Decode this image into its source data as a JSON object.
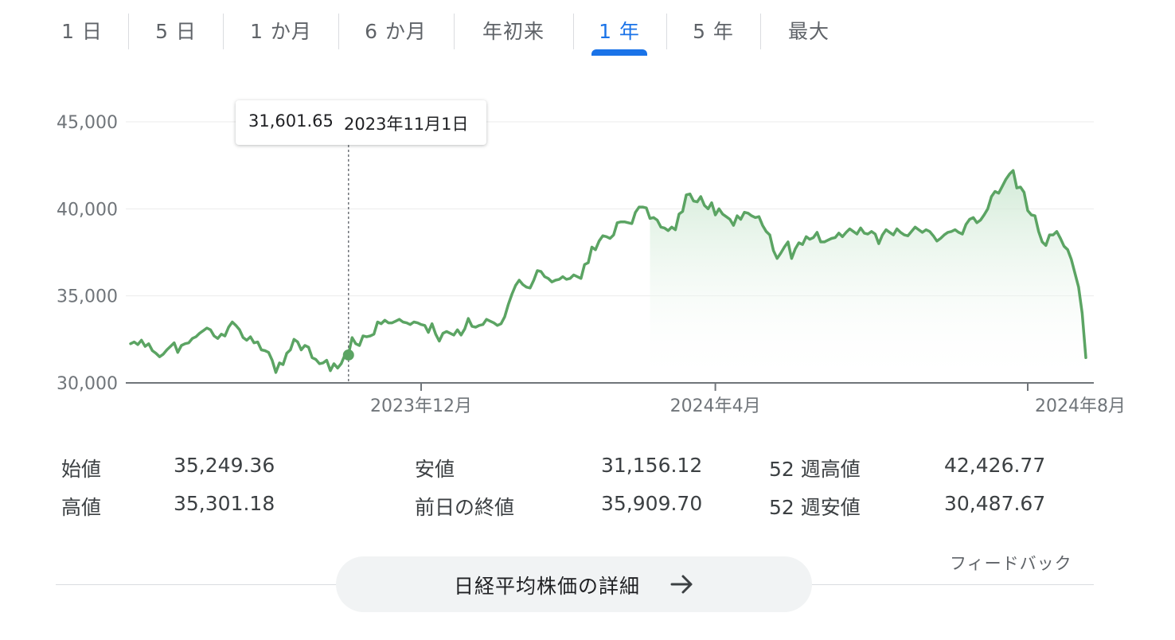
{
  "range_tabs": [
    "1 日",
    "5 日",
    "1 か月",
    "6 か月",
    "年初来",
    "1 年",
    "5 年",
    "最大"
  ],
  "selected_tab": "1 年",
  "tooltip": {
    "value": "31,601.65",
    "date": "2023年11月1日"
  },
  "stats": {
    "open": {
      "label": "始値",
      "value": "35,249.36"
    },
    "high": {
      "label": "高値",
      "value": "35,301.18"
    },
    "low": {
      "label": "安値",
      "value": "31,156.12"
    },
    "prev_close": {
      "label": "前日の終値",
      "value": "35,909.70"
    },
    "week52_high": {
      "label": "52 週高値",
      "value": "42,426.77"
    },
    "week52_low": {
      "label": "52 週安値",
      "value": "30,487.67"
    }
  },
  "details_button": "日経平均株価の詳細",
  "feedback": "フィードバック",
  "colors": {
    "accent": "#1a73e8",
    "line": "#5ba463",
    "area": "#e6f4ea",
    "grid": "#ebebeb"
  },
  "icons": {
    "details_arrow": "arrow-right-icon"
  },
  "chart_data": {
    "type": "area",
    "y_ticks": [
      "45,000",
      "40,000",
      "35,000",
      "30,000"
    ],
    "x_ticks": [
      "2023年12月",
      "2024年4月",
      "2024年8月"
    ],
    "ylim": [
      30000,
      45000
    ],
    "grid": true,
    "highlight": {
      "date": "2023年11月1日",
      "value": 31601.65
    },
    "series": [
      {
        "values": [
          32250,
          32350,
          32200,
          32450,
          32100,
          32250,
          31850,
          31700,
          31500,
          31650,
          31900,
          32100,
          32300,
          31750,
          32150,
          32250,
          32300,
          32550,
          32650,
          32850,
          33000,
          33150,
          33050,
          32700,
          32550,
          32800,
          32700,
          33200,
          33500,
          33300,
          33050,
          32600,
          32450,
          32650,
          32300,
          32350,
          31900,
          31850,
          31750,
          31300,
          30600,
          31150,
          31050,
          31700,
          31900,
          32500,
          32350,
          31900,
          32150,
          32050,
          31450,
          31350,
          31100,
          31150,
          31300,
          30700,
          31100,
          30850,
          31100,
          31600,
          31650,
          32600,
          32250,
          32150,
          32700,
          32650,
          32700,
          32800,
          33500,
          33400,
          33600,
          33450,
          33450,
          33550,
          33650,
          33500,
          33450,
          33350,
          33500,
          33450,
          33350,
          33300,
          32900,
          33400,
          32800,
          32400,
          32850,
          32950,
          32850,
          32750,
          33050,
          32750,
          33100,
          33700,
          33250,
          33200,
          33300,
          33350,
          33650,
          33550,
          33450,
          33300,
          33400,
          33800,
          34500,
          35100,
          35600,
          35900,
          35650,
          35500,
          35450,
          35900,
          36450,
          36400,
          36100,
          36000,
          35800,
          35900,
          35950,
          36100,
          35950,
          36000,
          36200,
          36100,
          36000,
          36800,
          36900,
          37800,
          37650,
          38150,
          38450,
          38400,
          38300,
          38500,
          39200,
          39250,
          39250,
          39200,
          39150,
          39800,
          40100,
          40100,
          40050,
          39450,
          39500,
          39350,
          38950,
          38900,
          38750,
          38950,
          38800,
          39700,
          39850,
          40800,
          40850,
          40450,
          40400,
          40700,
          40200,
          40000,
          40350,
          39650,
          40000,
          39700,
          39550,
          39400,
          39050,
          39600,
          39400,
          39800,
          39750,
          39600,
          39500,
          39550,
          39050,
          38700,
          38500,
          37600,
          37150,
          37450,
          37800,
          38100,
          37150,
          37700,
          38050,
          37950,
          38400,
          38250,
          38350,
          38650,
          38100,
          38100,
          38200,
          38300,
          38350,
          38600,
          38400,
          38650,
          38850,
          38700,
          38550,
          38900,
          38600,
          38550,
          38700,
          38550,
          38000,
          38500,
          38800,
          38650,
          38500,
          38850,
          38650,
          38500,
          38450,
          38700,
          38950,
          38800,
          38650,
          38800,
          38700,
          38450,
          38150,
          38300,
          38500,
          38650,
          38700,
          38800,
          38650,
          38550,
          39100,
          39400,
          39500,
          39200,
          39350,
          39650,
          40000,
          40700,
          41000,
          40900,
          41300,
          41700,
          42000,
          42200,
          41200,
          41250,
          40950,
          39900,
          39650,
          39600,
          38700,
          38100,
          37900,
          38500,
          38500,
          38700,
          38300,
          37850,
          37650,
          37100,
          36300,
          35500,
          34000,
          31450
        ],
        "color": "#5ba463"
      }
    ]
  }
}
